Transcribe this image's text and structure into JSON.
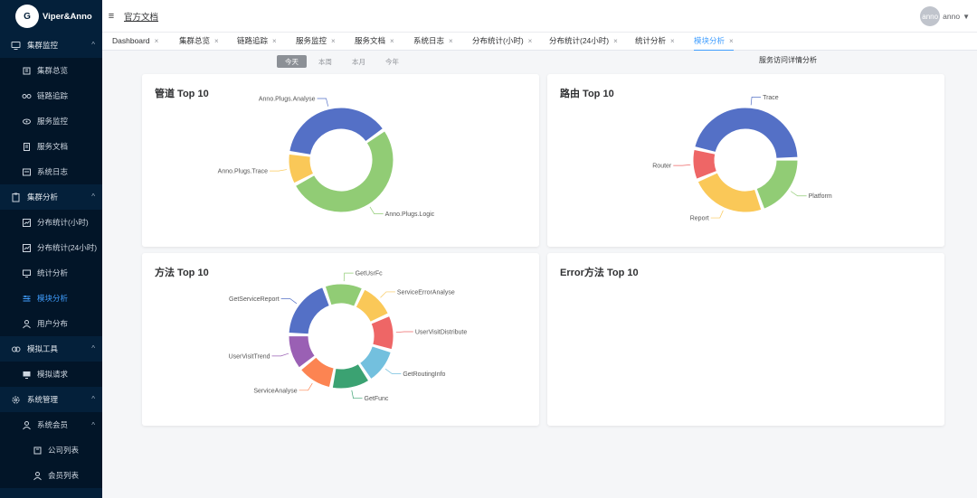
{
  "brand": {
    "logo_glyph": "G",
    "name": "Viper&Anno"
  },
  "header": {
    "doc_link": "官方文档",
    "avatar_text": "anno",
    "user_name": "anno"
  },
  "sidebar": {
    "groups": [
      {
        "label": "集群监控",
        "icon": "monitor-icon"
      },
      {
        "label": "集群分析",
        "icon": "clipboard-icon"
      },
      {
        "label": "模拟工具",
        "icon": "tool-icon"
      },
      {
        "label": "系统管理",
        "icon": "gear-icon"
      }
    ],
    "items": [
      {
        "label": "集群总览",
        "icon": "building-icon"
      },
      {
        "label": "链路追踪",
        "icon": "route-icon"
      },
      {
        "label": "服务监控",
        "icon": "eye-icon"
      },
      {
        "label": "服务文档",
        "icon": "doc-icon"
      },
      {
        "label": "系统日志",
        "icon": "log-icon"
      },
      {
        "label": "分布统计(小时)",
        "icon": "chart-icon"
      },
      {
        "label": "分布统计(24小时)",
        "icon": "chart-icon"
      },
      {
        "label": "统计分析",
        "icon": "screen-icon"
      },
      {
        "label": "模块分析",
        "icon": "sliders-icon"
      },
      {
        "label": "用户分布",
        "icon": "user-icon"
      },
      {
        "label": "模拟请求",
        "icon": "screen-icon"
      },
      {
        "label": "系统会员",
        "icon": "user-icon"
      },
      {
        "label": "公司列表",
        "icon": "building-icon"
      },
      {
        "label": "会员列表",
        "icon": "user-icon"
      }
    ]
  },
  "tabs": [
    {
      "label": "Dashboard"
    },
    {
      "label": "集群总览"
    },
    {
      "label": "链路追踪"
    },
    {
      "label": "服务监控"
    },
    {
      "label": "服务文档"
    },
    {
      "label": "系统日志"
    },
    {
      "label": "分布统计(小时)"
    },
    {
      "label": "分布统计(24小时)"
    },
    {
      "label": "统计分析"
    },
    {
      "label": "模块分析"
    }
  ],
  "period": {
    "options": [
      "今天",
      "本周",
      "本月",
      "今年"
    ],
    "selected": "今天"
  },
  "service_title": "服务访问详情分析",
  "colors": {
    "accent": "#409eff",
    "sidebar_bg": "#04203a"
  },
  "cards": {
    "pipeline": {
      "title": "管道 Top 10"
    },
    "route": {
      "title": "路由 Top 10"
    },
    "method": {
      "title": "方法 Top 10"
    },
    "error": {
      "title": "Error方法 Top 10"
    }
  },
  "chart_data": [
    {
      "type": "pie",
      "title": "管道 Top 10",
      "labels": [
        "Anno.Plugs.Analyse",
        "Anno.Plugs.Logic",
        "Anno.Plugs.Trace"
      ],
      "values": [
        38,
        52,
        10
      ],
      "colors": [
        "#5470c6",
        "#91cc75",
        "#fac858"
      ]
    },
    {
      "type": "pie",
      "title": "路由 Top 10",
      "labels": [
        "Trace",
        "Platform",
        "Report",
        "Router"
      ],
      "values": [
        46,
        20,
        24,
        10
      ],
      "colors": [
        "#5470c6",
        "#91cc75",
        "#fac858",
        "#ee6666"
      ]
    },
    {
      "type": "pie",
      "title": "方法 Top 10",
      "labels": [
        "GetServiceReport",
        "GetUsrFc",
        "ServiceErrorAnalyse",
        "UserVisitDistribute",
        "GetRoutingInfo",
        "GetFunc",
        "ServiceAnalyse",
        "UserVisitTrend"
      ],
      "values": [
        17,
        11,
        10,
        10,
        10,
        11,
        10,
        10
      ],
      "colors": [
        "#5470c6",
        "#91cc75",
        "#fac858",
        "#ee6666",
        "#73c0de",
        "#3ba272",
        "#fc8452",
        "#9a60b4"
      ]
    }
  ]
}
